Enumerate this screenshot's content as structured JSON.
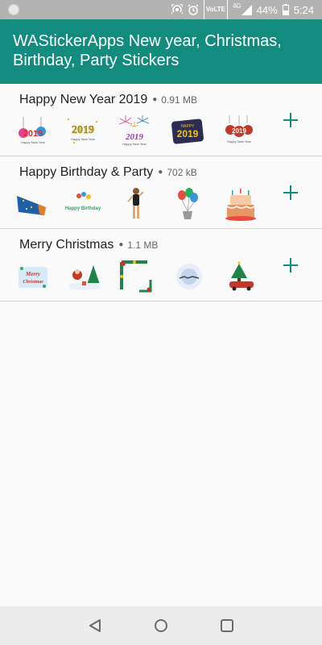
{
  "status_bar": {
    "network": "4G",
    "volte": "VoLTE",
    "battery": "44%",
    "time": "5:24"
  },
  "app_bar": {
    "title": "WAStickerApps New year, Christmas, Birthday, Party Stickers"
  },
  "packs": [
    {
      "name": "Happy New Year 2019",
      "size": "0.91 MB",
      "stickers": [
        "2019-ornament-sticker",
        "2019-gold-sticker",
        "2019-fireworks-sticker",
        "happy-2019-badge-sticker",
        "2019-baubles-sticker"
      ]
    },
    {
      "name": "Happy Birthday & Party",
      "size": "702 kB",
      "stickers": [
        "party-horn-sticker",
        "happy-birthday-text-sticker",
        "party-girl-sticker",
        "balloons-sticker",
        "birthday-cake-sticker"
      ]
    },
    {
      "name": "Merry Christmas",
      "size": "1.1 MB",
      "stickers": [
        "merry-christmas-text-sticker",
        "santa-tree-sticker",
        "christmas-frame-sticker",
        "santa-sleigh-moon-sticker",
        "christmas-tree-car-sticker"
      ]
    }
  ],
  "sticker_text": {
    "y2019": "2019",
    "happy": "HAPPY",
    "happy_birthday": "Happy Birthday",
    "merry": "Merry",
    "christmas": "Christmas"
  },
  "colors": {
    "primary": "#128c7e",
    "status_bar": "#b3b3b3",
    "background": "#fafafa",
    "divider": "#d6d6d6"
  },
  "nav_bar": {
    "back": "back-icon",
    "home": "home-icon",
    "recents": "recents-icon"
  }
}
